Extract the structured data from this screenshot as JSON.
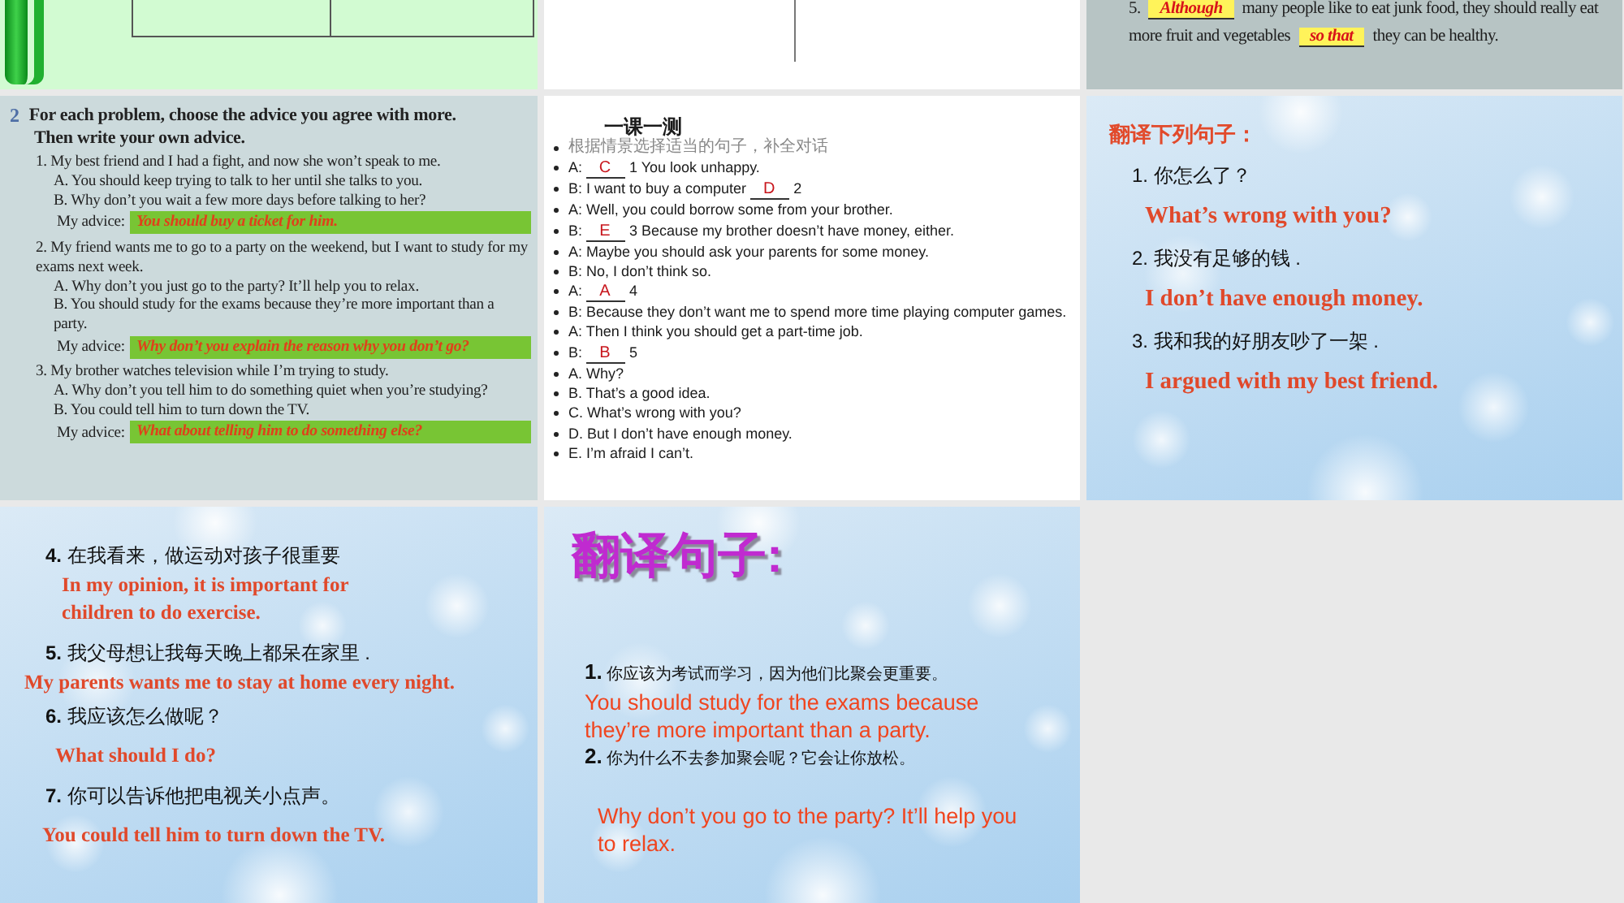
{
  "slides": [
    {
      "kind": "table"
    },
    {
      "kind": "lined"
    },
    {
      "kind": "fill",
      "blocks": [
        {
          "kind": "line",
          "parts": [
            {
              "kind": "text",
              "text": "5."
            },
            {
              "kind": "answer",
              "text": "Although"
            },
            {
              "kind": "text",
              "text": "many people like to eat junk food, they should really eat"
            }
          ]
        },
        {
          "kind": "line",
          "parts": [
            {
              "kind": "text",
              "text": "more fruit and vegetables"
            },
            {
              "kind": "answer",
              "text": "so that"
            },
            {
              "kind": "text",
              "text": "they can be healthy."
            }
          ]
        }
      ]
    },
    {
      "kind": "advice",
      "blocks": [
        {
          "kind": "heading",
          "parts": [
            {
              "kind": "number",
              "text": "2"
            },
            {
              "kind": "text",
              "text": "For each problem, choose the advice you agree with more."
            }
          ]
        },
        {
          "kind": "heading",
          "parts": [
            {
              "kind": "text",
              "text": "Then write your own advice."
            }
          ]
        },
        {
          "kind": "item",
          "text": "1. My best friend and I had a fight, and now she won’t speak to me."
        },
        {
          "kind": "option",
          "text": "A. You should keep trying to talk to her until she talks to you."
        },
        {
          "kind": "option",
          "text": "B. Why don’t you wait a few more days before talking to her?"
        },
        {
          "kind": "advice",
          "parts": [
            {
              "kind": "text",
              "text": "My advice:"
            },
            {
              "kind": "answer",
              "text": "You should buy a ticket for him."
            }
          ]
        },
        {
          "kind": "item",
          "text": "2. My friend wants me to go to a party on the weekend, but I want to study for my exams next week."
        },
        {
          "kind": "option",
          "text": "A. Why don’t you just go to the party? It’ll help you to relax."
        },
        {
          "kind": "option",
          "text": "B. You should study for the exams because they’re more important than a party."
        },
        {
          "kind": "advice",
          "parts": [
            {
              "kind": "text",
              "text": "My advice:"
            },
            {
              "kind": "answer",
              "text": "Why don’t you explain the reason why you don’t go?"
            }
          ]
        },
        {
          "kind": "item",
          "text": "3. My brother watches television while I’m trying to study."
        },
        {
          "kind": "option",
          "text": "A. Why don’t you tell him to do something quiet when you’re studying?"
        },
        {
          "kind": "option",
          "text": "B. You could tell him to turn down the TV."
        },
        {
          "kind": "advice",
          "parts": [
            {
              "kind": "text",
              "text": "My advice:"
            },
            {
              "kind": "answer",
              "text": "What about telling him to do something  else?"
            }
          ]
        }
      ]
    },
    {
      "kind": "quiz",
      "blocks": [
        {
          "kind": "title",
          "text": "一课一测"
        },
        {
          "kind": "bullet",
          "parts": [
            {
              "kind": "instruction",
              "text": "根据情景选择适当的句子，补全对话"
            }
          ]
        },
        {
          "kind": "bullet",
          "parts": [
            {
              "kind": "text",
              "text": "A:"
            },
            {
              "kind": "answer",
              "text": "C"
            },
            {
              "kind": "text",
              "text": "1 You look unhappy."
            }
          ]
        },
        {
          "kind": "bullet",
          "parts": [
            {
              "kind": "text",
              "text": "B: I want to buy a computer"
            },
            {
              "kind": "answer",
              "text": "D"
            },
            {
              "kind": "text",
              "text": "2"
            }
          ]
        },
        {
          "kind": "bullet",
          "parts": [
            {
              "kind": "text",
              "text": "A: Well, you could borrow some from your brother."
            }
          ]
        },
        {
          "kind": "bullet",
          "parts": [
            {
              "kind": "text",
              "text": "B:"
            },
            {
              "kind": "answer",
              "text": "E"
            },
            {
              "kind": "text",
              "text": "3 Because my brother doesn’t have money, either."
            }
          ]
        },
        {
          "kind": "bullet",
          "parts": [
            {
              "kind": "text",
              "text": "A: Maybe you should ask your parents for some money."
            }
          ]
        },
        {
          "kind": "bullet",
          "parts": [
            {
              "kind": "text",
              "text": "B: No, I don’t think so."
            }
          ]
        },
        {
          "kind": "bullet",
          "parts": [
            {
              "kind": "text",
              "text": "A:"
            },
            {
              "kind": "answer",
              "text": "A"
            },
            {
              "kind": "text",
              "text": "4"
            }
          ]
        },
        {
          "kind": "bullet",
          "parts": [
            {
              "kind": "text",
              "text": "B: Because they don’t want me to spend more time playing computer games."
            }
          ]
        },
        {
          "kind": "bullet",
          "parts": [
            {
              "kind": "text",
              "text": "A: Then I think you should get a part-time job."
            }
          ]
        },
        {
          "kind": "bullet",
          "parts": [
            {
              "kind": "text",
              "text": "B:"
            },
            {
              "kind": "answer",
              "text": "B"
            },
            {
              "kind": "text",
              "text": "5"
            }
          ]
        },
        {
          "kind": "bullet",
          "parts": [
            {
              "kind": "text",
              "text": "A. Why?"
            }
          ]
        },
        {
          "kind": "bullet",
          "parts": [
            {
              "kind": "text",
              "text": "B. That’s a good idea."
            }
          ]
        },
        {
          "kind": "bullet",
          "parts": [
            {
              "kind": "text",
              "text": "C. What’s wrong with you?"
            }
          ]
        },
        {
          "kind": "bullet",
          "parts": [
            {
              "kind": "text",
              "text": "D. But I don’t have enough money."
            }
          ]
        },
        {
          "kind": "bullet",
          "parts": [
            {
              "kind": "text",
              "text": "E. I’m afraid I can’t."
            }
          ]
        }
      ]
    },
    {
      "kind": "translate",
      "blocks": [
        {
          "kind": "title",
          "text": "翻译下列句子："
        },
        {
          "kind": "prompt",
          "text": "1. 你怎么了？"
        },
        {
          "kind": "answer",
          "text": "What’s wrong with you?"
        },
        {
          "kind": "prompt",
          "text": "2.  我没有足够的钱 ."
        },
        {
          "kind": "answer",
          "text": "I don’t have enough money."
        },
        {
          "kind": "prompt",
          "text": "3.  我和我的好朋友吵了一架 ."
        },
        {
          "kind": "answer",
          "text": "I argued with my best friend."
        }
      ]
    },
    {
      "kind": "translate-more",
      "blocks": [
        {
          "kind": "prompt",
          "text": "**4.** 在我看来，做运动对孩子很重要"
        },
        {
          "kind": "answer",
          "text": "In my opinion, it is important for children to do exercise."
        },
        {
          "kind": "prompt",
          "text": "**5.** 我父母想让我每天晚上都呆在家里 ."
        },
        {
          "kind": "answer",
          "text": "My parents wants me to stay at home every night."
        },
        {
          "kind": "prompt",
          "text": "**6.** 我应该怎么做呢？"
        },
        {
          "kind": "answer",
          "text": "What should I do?"
        },
        {
          "kind": "prompt",
          "text": "**7.** 你可以告诉他把电视关小点声。"
        },
        {
          "kind": "answer",
          "text": "You could tell him to turn down the TV."
        }
      ]
    },
    {
      "kind": "translate-big",
      "blocks": [
        {
          "kind": "title",
          "text": "翻译句子:"
        },
        {
          "kind": "prompt",
          "text": "**1.** 你应该为考试而学习，因为他们比聚会更重要。"
        },
        {
          "kind": "answer",
          "text": "You should study for the exams because they’re more important than a party."
        },
        {
          "kind": "prompt",
          "text": "**2.** 你为什么不去参加聚会呢？它会让你放松。"
        },
        {
          "kind": "answer",
          "text": "Why don’t you go to the party? It’ll help you to relax."
        }
      ]
    }
  ]
}
